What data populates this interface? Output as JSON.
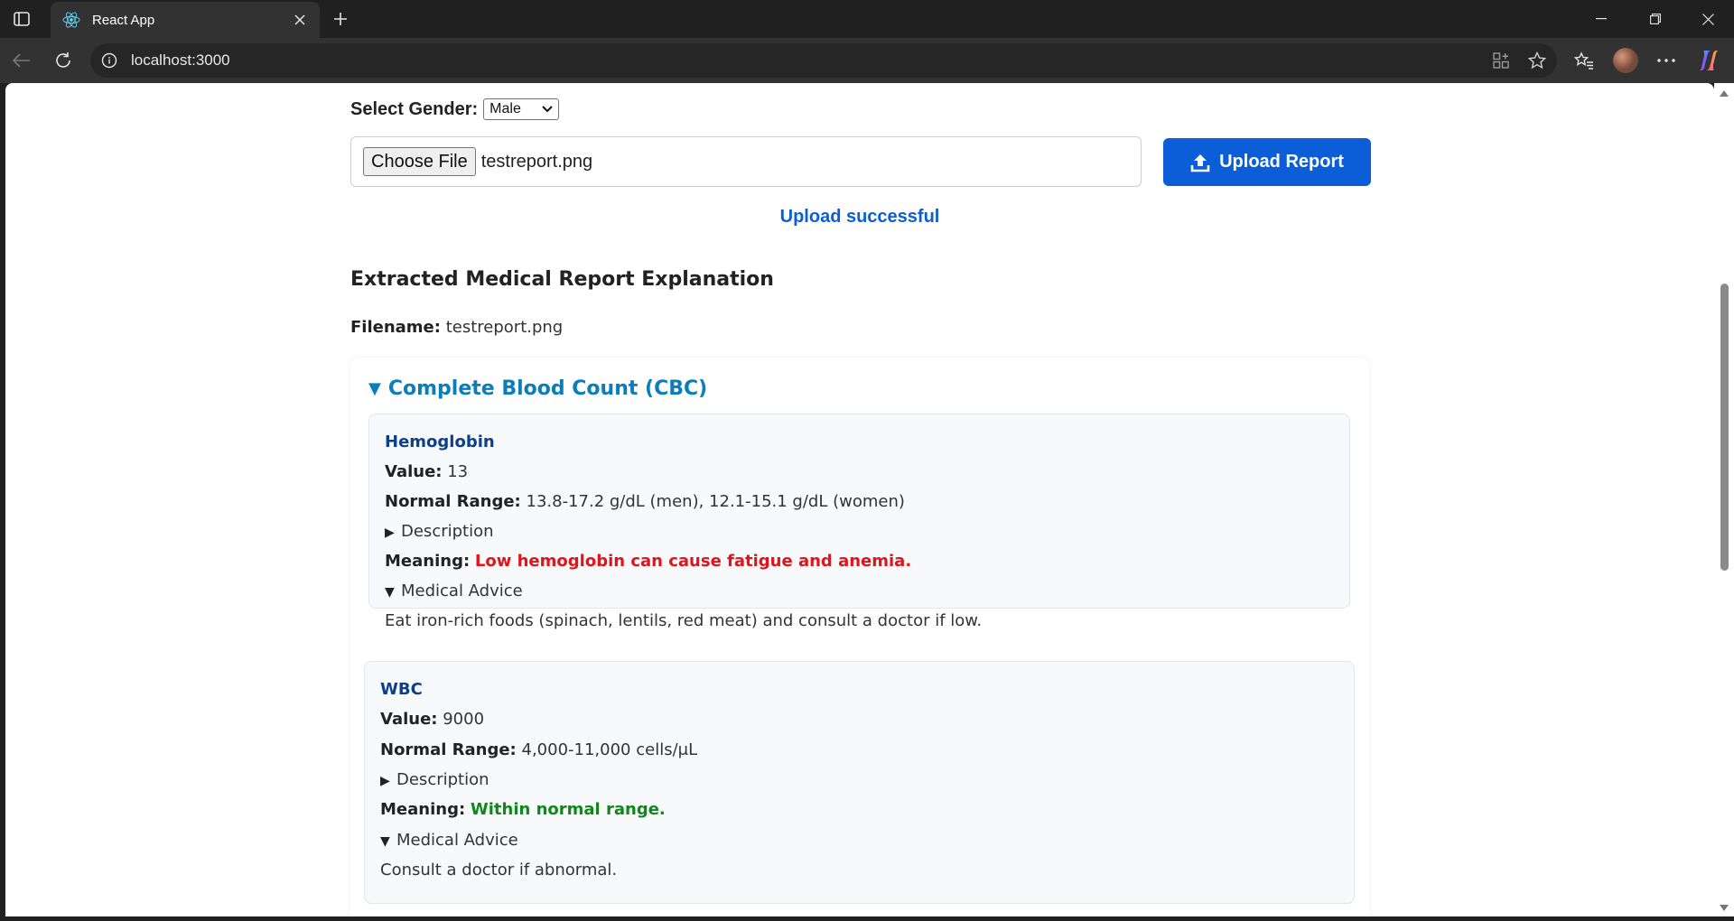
{
  "browser": {
    "tab_title": "React App",
    "url": "localhost:3000"
  },
  "form": {
    "gender_label": "Select Gender:",
    "gender_value": "Male",
    "choose_file_label": "Choose File",
    "file_name": "testreport.png",
    "upload_button_label": "Upload Report",
    "status_message": "Upload successful"
  },
  "report": {
    "heading": "Extracted Medical Report Explanation",
    "filename_label": "Filename:",
    "filename_value": "testreport.png",
    "category": "Complete Blood Count (CBC)",
    "tests": [
      {
        "name": "Hemoglobin",
        "value_label": "Value:",
        "value": "13",
        "range_label": "Normal Range:",
        "range": "13.8-17.2 g/dL (men), 12.1-15.1 g/dL (women)",
        "description_label": "Description",
        "meaning_label": "Meaning:",
        "meaning": "Low hemoglobin can cause fatigue and anemia.",
        "advice_label": "Medical Advice",
        "advice": "Eat iron-rich foods (spinach, lentils, red meat) and consult a doctor if low."
      },
      {
        "name": "WBC",
        "value_label": "Value:",
        "value": "9000",
        "range_label": "Normal Range:",
        "range": "4,000-11,000 cells/μL",
        "description_label": "Description",
        "meaning_label": "Meaning:",
        "meaning": "Within normal range.",
        "advice_label": "Medical Advice",
        "advice": "Consult a doctor if abnormal."
      }
    ]
  },
  "colors": {
    "accent_blue": "#0b5ed7",
    "category_blue": "#0a7dbb",
    "test_name_blue": "#0d3f8a",
    "meaning_abnormal": "#e0141c",
    "meaning_normal": "#11861d"
  },
  "icons": [
    "sidebar-toggle-icon",
    "react-logo-icon",
    "close-icon",
    "plus-icon",
    "minimize-icon",
    "restore-icon",
    "back-icon",
    "reload-icon",
    "info-icon",
    "apps-icon",
    "star-icon",
    "favorites-icon",
    "more-icon",
    "copilot-icon",
    "upload-icon"
  ]
}
